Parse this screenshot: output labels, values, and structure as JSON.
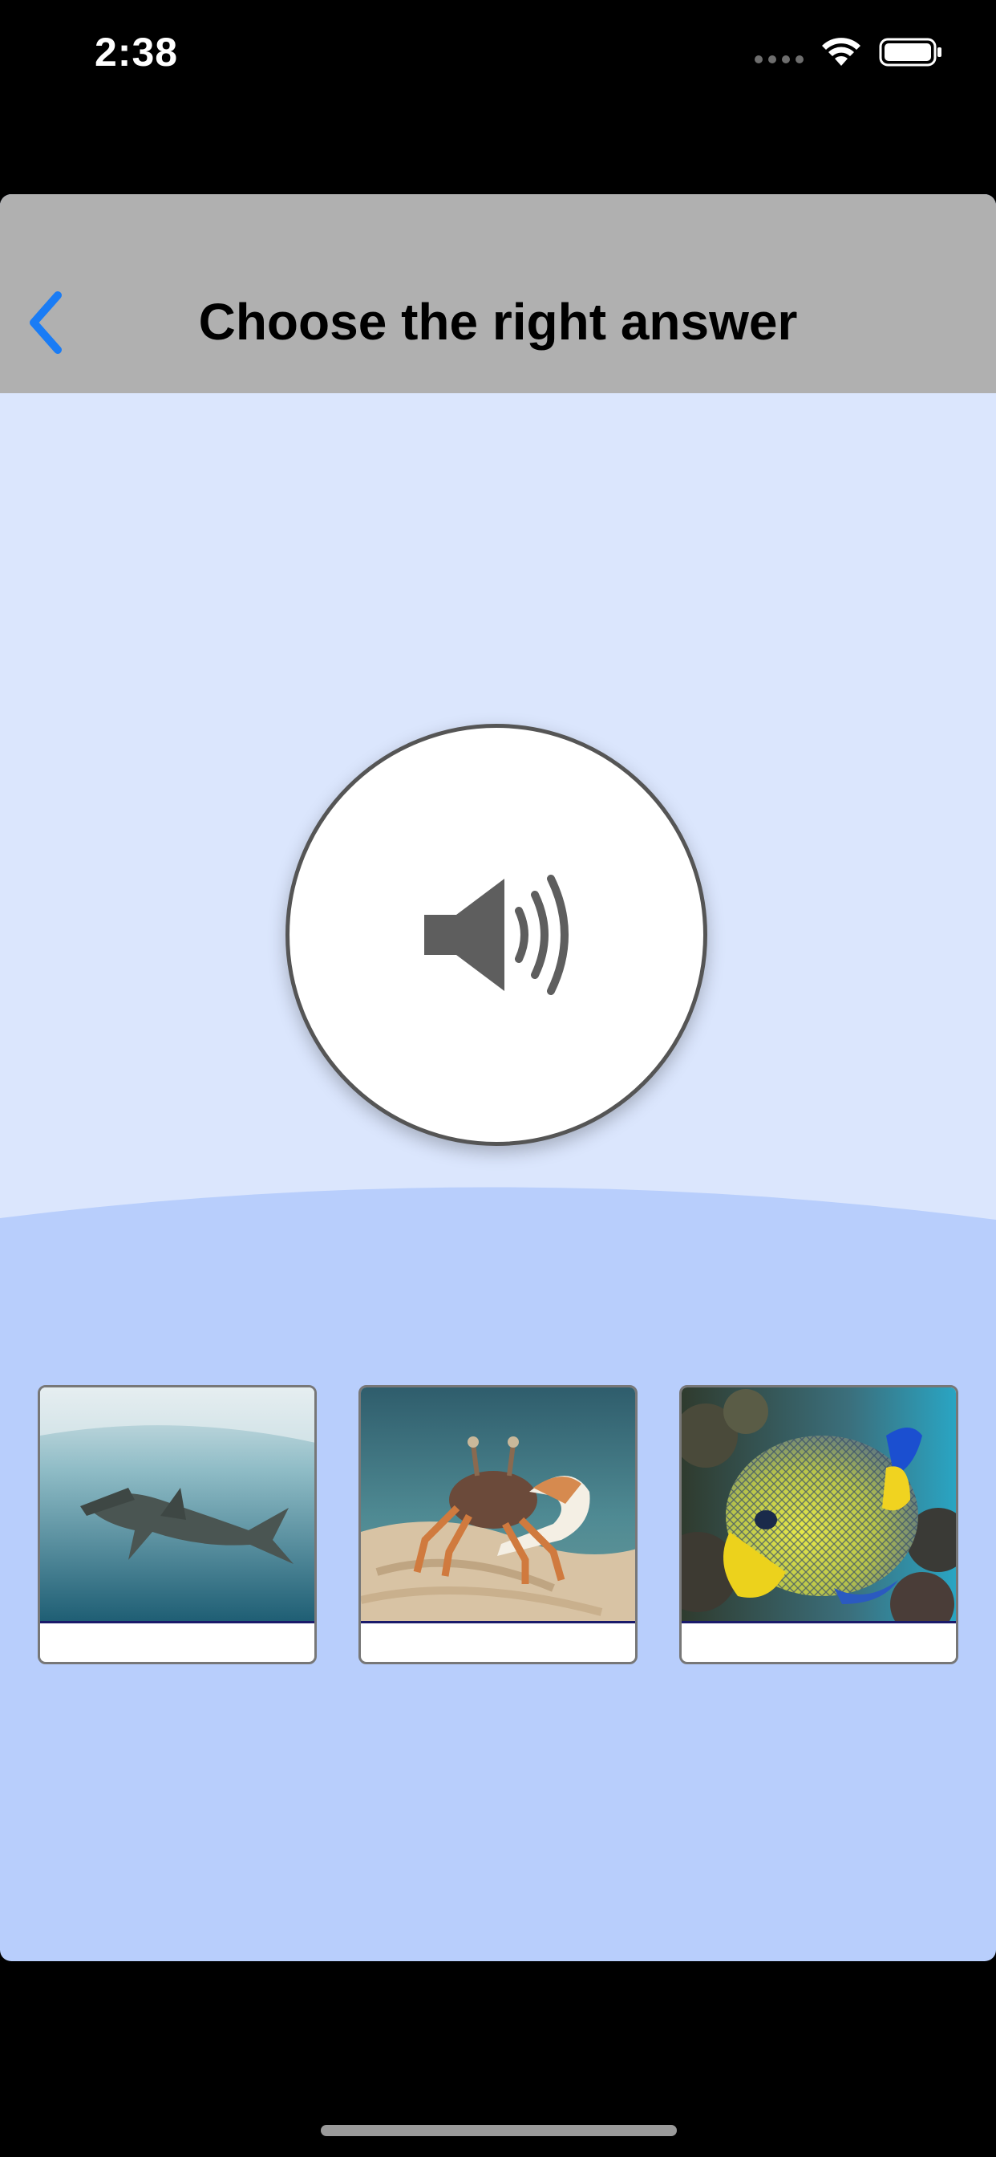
{
  "status_bar": {
    "time": "2:38"
  },
  "nav": {
    "title": "Choose the right answer",
    "back_icon": "chevron-left-icon"
  },
  "speaker": {
    "icon": "speaker-volume-icon"
  },
  "choices": [
    {
      "id": "hammerhead-shark",
      "label": ""
    },
    {
      "id": "fiddler-crab",
      "label": ""
    },
    {
      "id": "angelfish",
      "label": ""
    }
  ],
  "colors": {
    "accent": "#1a7cf5",
    "nav_background": "#b0b0b0",
    "upper_background": "#dbe6fd",
    "lower_background": "#b8cefc"
  }
}
